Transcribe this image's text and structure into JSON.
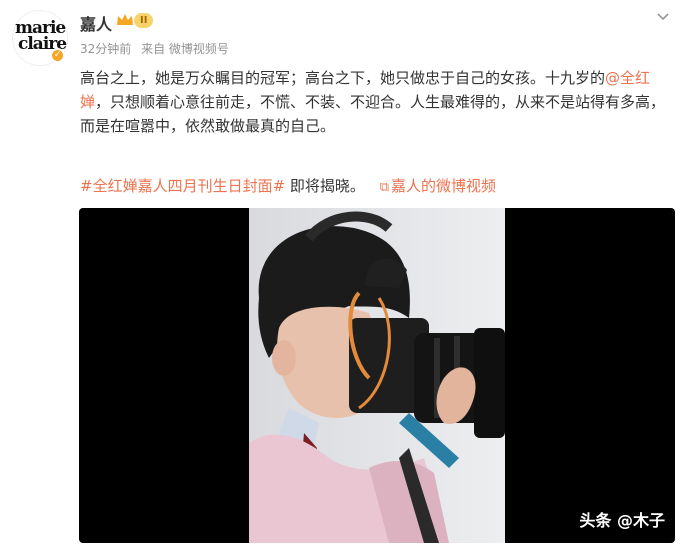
{
  "post": {
    "avatar_logo_line1": "marie",
    "avatar_logo_line2": "claire",
    "username": "嘉人",
    "vip_level": "II",
    "time": "32分钟前",
    "source": "来自 微博视频号",
    "text_p1": "高台之上，她是万众瞩目的冠军；高台之下，她只做忠于自己的女孩。十九岁的",
    "mention": "@全红婵",
    "text_p2": "，只想顺着心意往前走，不慌、不装、不迎合。人生最难得的，从来不是站得有多高，而是在喧嚣中，依然敢做最真的自己。",
    "topic": "#全红婵嘉人四月刊生日封面#",
    "tag_text": "即将揭晓。",
    "video_link": "嘉人的微博视频"
  },
  "video": {
    "watermark": "头条 @木子"
  },
  "colors": {
    "accent": "#eb7350",
    "meta": "#939393",
    "verified": "#f5a623"
  },
  "icons": {
    "crown": "crown-icon",
    "verified": "verified-badge-icon",
    "dropdown": "chevron-down-icon",
    "video": "video-icon"
  }
}
